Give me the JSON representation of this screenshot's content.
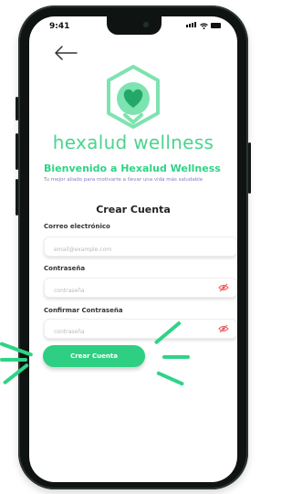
{
  "status_bar": {
    "time": "9:41"
  },
  "brand": {
    "name": "hexalud wellness",
    "accent": "#4bd48f"
  },
  "welcome": {
    "title": "Bienvenido a Hexalud Wellness",
    "tagline": "Tu mejor aliado para motivarte a llevar una vida más saludable"
  },
  "form": {
    "title": "Crear Cuenta",
    "email": {
      "label": "Correo electrónico",
      "placeholder": "email@example.com",
      "value": ""
    },
    "password": {
      "label": "Contraseña",
      "placeholder": "contraseña",
      "value": ""
    },
    "confirm_password": {
      "label": "Confirmar Contraseña",
      "placeholder": "contraseña",
      "value": ""
    },
    "submit_label": "Crear Cuenta"
  },
  "icons": {
    "back": "arrow-left-icon",
    "logo": "hexagon-heart-icon",
    "password_toggle": "eye-off-icon"
  },
  "colors": {
    "primary": "#2ecf82",
    "tagline": "#8a7ac0",
    "eye_off": "#e85a5a"
  }
}
